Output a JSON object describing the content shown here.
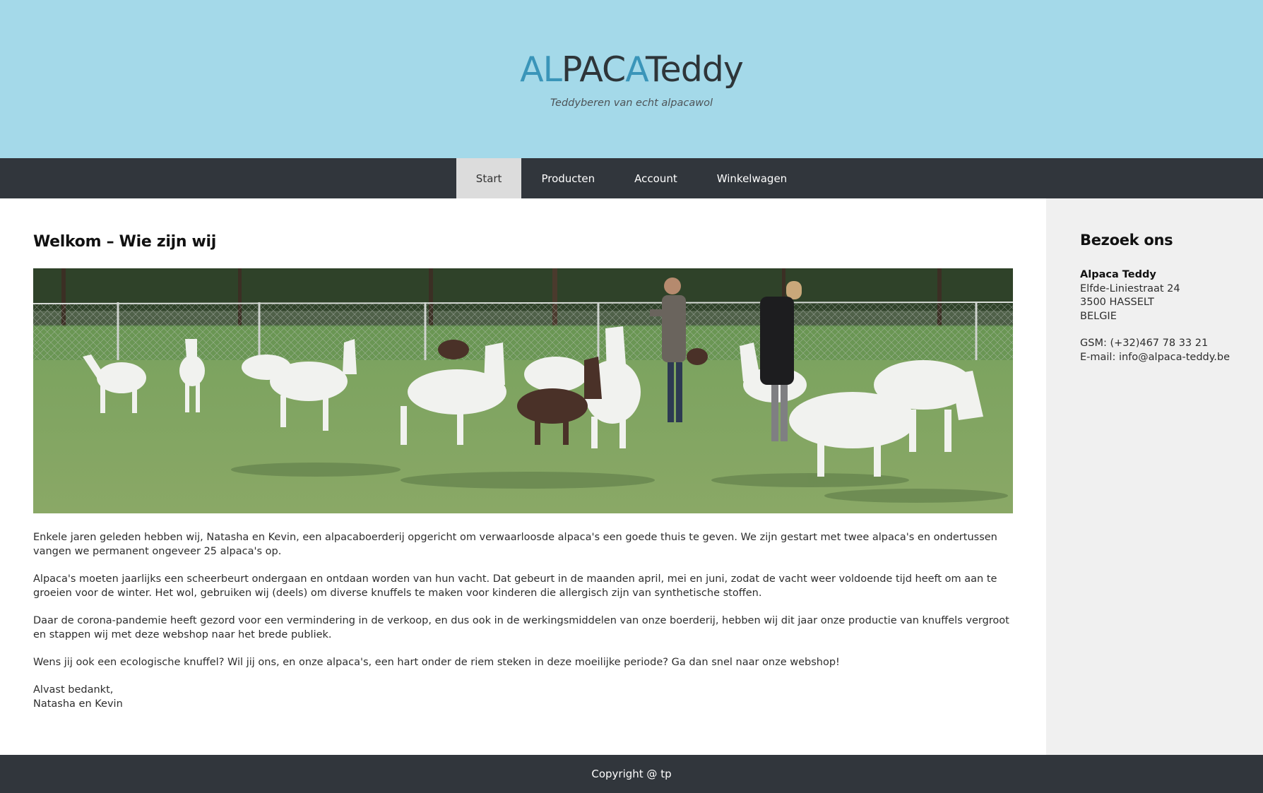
{
  "header": {
    "logo": {
      "part1": "AL",
      "part2": "PAC",
      "part3": "A",
      "part4": "Teddy"
    },
    "tagline": "Teddyberen van echt alpacawol"
  },
  "nav": {
    "items": [
      {
        "label": "Start",
        "active": true
      },
      {
        "label": "Producten",
        "active": false
      },
      {
        "label": "Account",
        "active": false
      },
      {
        "label": "Winkelwagen",
        "active": false
      }
    ]
  },
  "main": {
    "title": "Welkom – Wie zijn wij",
    "paragraphs": [
      "Enkele jaren geleden hebben wij, Natasha en Kevin, een alpacaboerderij opgericht om verwaarloosde alpaca's een goede thuis te geven. We zijn gestart met twee alpaca's en ondertussen vangen we permanent ongeveer 25 alpaca's op.",
      "Alpaca's moeten jaarlijks een scheerbeurt ondergaan en ontdaan worden van hun vacht. Dat gebeurt in de maanden april, mei en juni, zodat de vacht weer voldoende tijd heeft om aan te groeien voor de winter. Het wol, gebruiken wij (deels) om diverse knuffels te maken voor kinderen die allergisch zijn van synthetische stoffen.",
      "Daar de corona-pandemie heeft gezord voor een vermindering in de verkoop, en dus ook in de werkingsmiddelen van onze boerderij, hebben wij dit jaar onze productie van knuffels vergroot en stappen wij met deze webshop naar het brede publiek.",
      "Wens jij ook een ecologische knuffel? Wil jij ons, en onze alpaca's, een hart onder de riem steken in deze moeilijke periode? Ga dan snel naar onze webshop!"
    ],
    "closing": {
      "line1": "Alvast bedankt,",
      "line2": "Natasha en Kevin"
    }
  },
  "sidebar": {
    "title": "Bezoek ons",
    "name": "Alpaca Teddy",
    "street": "Elfde-Liniestraat 24",
    "city": "3500 HASSELT",
    "country": "BELGIE",
    "phone": "GSM: (+32)467 78 33 21",
    "email": "E-mail: info@alpaca-teddy.be"
  },
  "footer": {
    "copyright": "Copyright @ tp"
  },
  "colors": {
    "header_bg": "#a4d9e9",
    "nav_bg": "#31363c",
    "nav_active_bg": "#dcdcdc",
    "logo_accent": "#3a95b9",
    "sidebar_bg": "#f0f0f0"
  }
}
